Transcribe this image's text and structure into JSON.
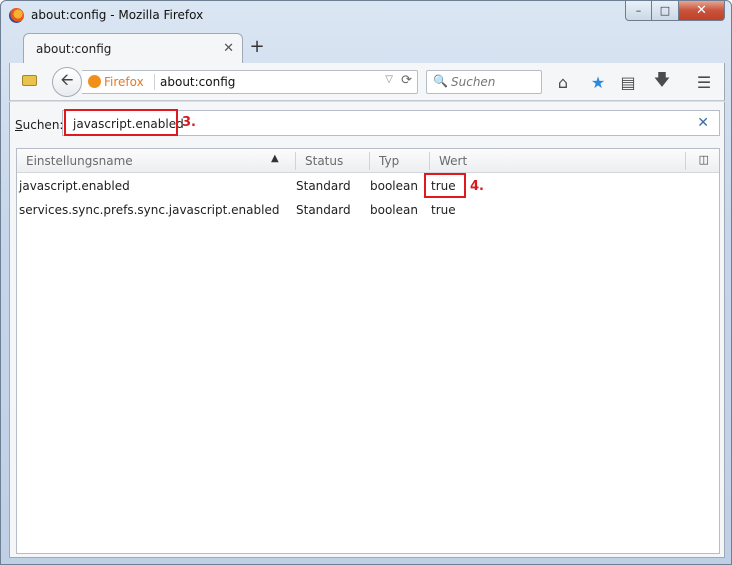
{
  "window": {
    "title": "about:config - Mozilla Firefox"
  },
  "tabs": [
    {
      "label": "about:config"
    }
  ],
  "navbar": {
    "identity_label": "Firefox",
    "url": "about:config",
    "search_placeholder": "Suchen"
  },
  "filter": {
    "label_prefix": "S",
    "label_rest": "uchen:",
    "value": "javascript.enabled",
    "annotation": "3."
  },
  "table": {
    "columns": [
      "Einstellungsname",
      "Status",
      "Typ",
      "Wert"
    ],
    "rows": [
      {
        "name": "javascript.enabled",
        "status": "Standard",
        "type": "boolean",
        "value": "true"
      },
      {
        "name": "services.sync.prefs.sync.javascript.enabled",
        "status": "Standard",
        "type": "boolean",
        "value": "true"
      }
    ],
    "value_annotation": "4."
  },
  "colors": {
    "highlight": "#e0191d",
    "firefox_orange": "#e4792a",
    "bookmark_star": "#2a8adf"
  },
  "icons": [
    "firefox-logo-icon",
    "back-arrow-icon",
    "reload-icon",
    "search-icon",
    "home-icon",
    "bookmark-star-icon",
    "reading-list-icon",
    "download-icon",
    "menu-icon",
    "column-picker-icon"
  ]
}
